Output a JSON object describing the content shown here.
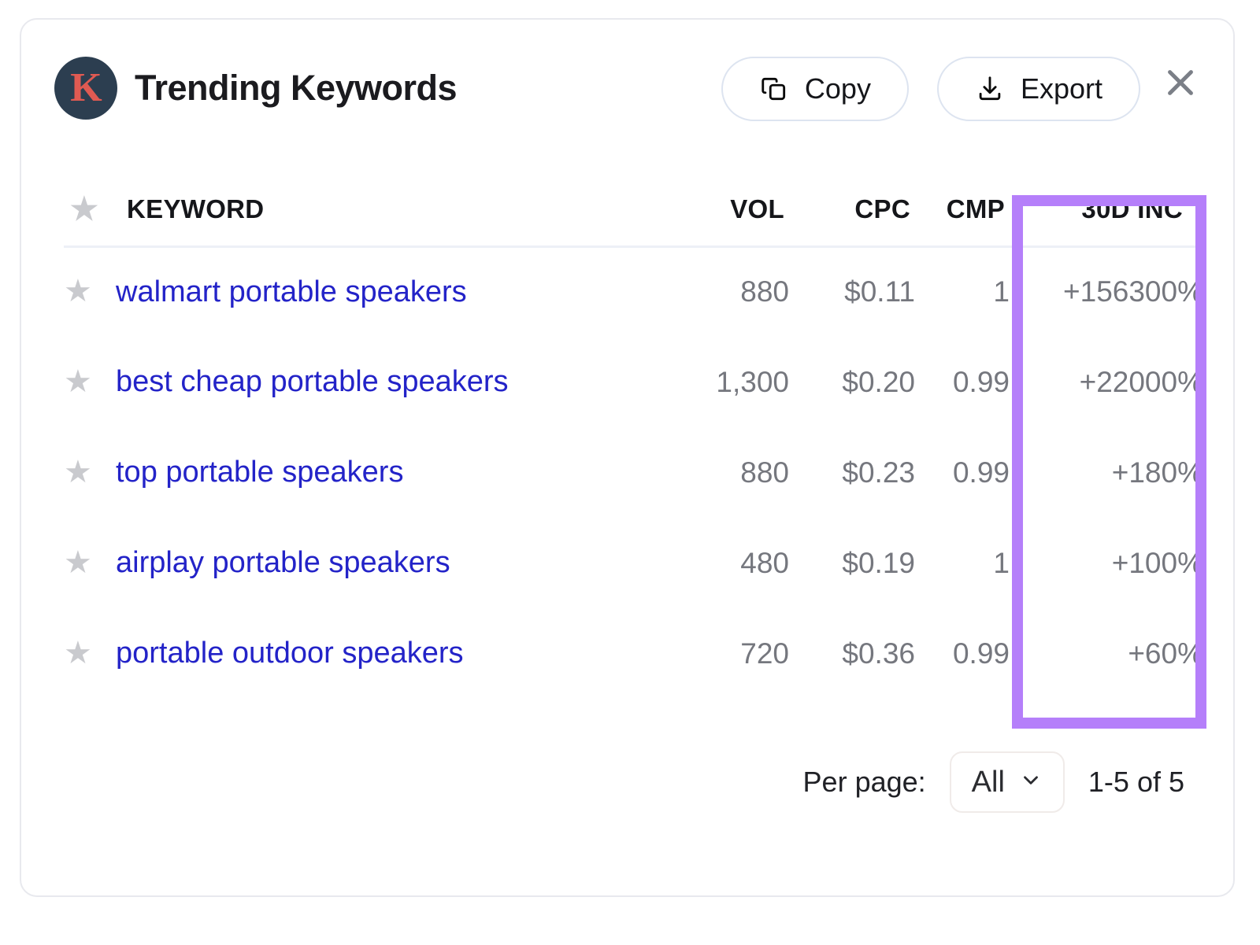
{
  "header": {
    "logo_letter": "K",
    "logo_bg": "#2c3e50",
    "logo_color": "#e05a52",
    "title": "Trending Keywords",
    "copy_label": "Copy",
    "export_label": "Export"
  },
  "table": {
    "columns": [
      "KEYWORD",
      "VOL",
      "CPC",
      "CMP",
      "30D INC"
    ],
    "rows": [
      {
        "keyword": "walmart portable speakers",
        "vol": "880",
        "cpc": "$0.11",
        "cmp": "1",
        "inc": "+156300%"
      },
      {
        "keyword": "best cheap portable speakers",
        "vol": "1,300",
        "cpc": "$0.20",
        "cmp": "0.99",
        "inc": "+22000%"
      },
      {
        "keyword": "top portable speakers",
        "vol": "880",
        "cpc": "$0.23",
        "cmp": "0.99",
        "inc": "+180%"
      },
      {
        "keyword": "airplay portable speakers",
        "vol": "480",
        "cpc": "$0.19",
        "cmp": "1",
        "inc": "+100%"
      },
      {
        "keyword": "portable outdoor speakers",
        "vol": "720",
        "cpc": "$0.36",
        "cmp": "0.99",
        "inc": "+60%"
      }
    ],
    "star_glyph": "★"
  },
  "highlight": {
    "color": "#b57ffa",
    "target_column": "30D INC"
  },
  "footer": {
    "per_page_label": "Per page:",
    "per_page_value": "All",
    "range_label": "1-5 of 5"
  },
  "colors": {
    "link": "#2323c8",
    "muted": "#75777e",
    "border": "#e8e9ee",
    "accent_purple": "#b57ffa"
  }
}
